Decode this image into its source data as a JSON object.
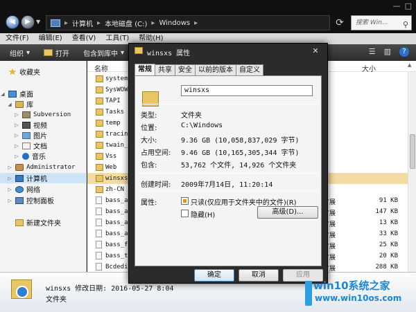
{
  "address": {
    "segments": [
      "计算机",
      "本地磁盘 (C:)",
      "Windows"
    ],
    "search_placeholder": "搜索 Win..."
  },
  "menu": [
    "文件(F)",
    "编辑(E)",
    "查看(V)",
    "工具(T)",
    "帮助(H)"
  ],
  "toolbar": {
    "organize": "组织",
    "open": "打开",
    "include_in_library": "包含到库中"
  },
  "navpane": {
    "favorites": "收藏夹",
    "desktop": "桌面",
    "libraries": "库",
    "subversion": "Subversion",
    "videos": "视频",
    "pictures": "图片",
    "documents": "文档",
    "music": "音乐",
    "administrator": "Administrator",
    "computer": "计算机",
    "network": "网络",
    "control_panel": "控制面板",
    "new_folder": "新建文件夹"
  },
  "filelist": {
    "col_name": "名称",
    "col_size": "大小",
    "rows": [
      {
        "name": "system",
        "type": "",
        "size": "",
        "kind": "folder"
      },
      {
        "name": "SysWOW",
        "type": "",
        "size": "",
        "kind": "folder"
      },
      {
        "name": "TAPI",
        "type": "",
        "size": "",
        "kind": "folder"
      },
      {
        "name": "Tasks",
        "type": "",
        "size": "",
        "kind": "folder"
      },
      {
        "name": "temp",
        "type": "",
        "size": "",
        "kind": "folder"
      },
      {
        "name": "tracin",
        "type": "",
        "size": "",
        "kind": "folder"
      },
      {
        "name": "twain_",
        "type": "",
        "size": "",
        "kind": "folder"
      },
      {
        "name": "Vss",
        "type": "",
        "size": "",
        "kind": "folder"
      },
      {
        "name": "Web",
        "type": "",
        "size": "",
        "kind": "folder"
      },
      {
        "name": "winsxs",
        "type": "",
        "size": "",
        "kind": "folder"
      },
      {
        "name": "zh-CN",
        "type": "",
        "size": "",
        "kind": "folder"
      },
      {
        "name": "bass_a",
        "type": "扩展",
        "size": "91 KB",
        "kind": "file"
      },
      {
        "name": "bass_a",
        "type": "扩展",
        "size": "147 KB",
        "kind": "file"
      },
      {
        "name": "bass_a",
        "type": "扩展",
        "size": "13 KB",
        "kind": "file"
      },
      {
        "name": "bass_a",
        "type": "扩展",
        "size": "33 KB",
        "kind": "file"
      },
      {
        "name": "bass_f",
        "type": "扩展",
        "size": "25 KB",
        "kind": "file"
      },
      {
        "name": "bass_t",
        "type": "扩展",
        "size": "20 KB",
        "kind": "file"
      },
      {
        "name": "Bcdedi",
        "type": "扩展",
        "size": "288 KB",
        "kind": "file"
      }
    ]
  },
  "details": {
    "name_line": "winsxs 修改日期: 2016-05-27 8:04",
    "type": "文件夹"
  },
  "dialog": {
    "title": "winsxs 属性",
    "close_glyph": "✕",
    "tabs": [
      "常规",
      "共享",
      "安全",
      "以前的版本",
      "自定义"
    ],
    "folder_name": "winsxs",
    "props": [
      {
        "label": "类型:",
        "value": "文件夹"
      },
      {
        "label": "位置:",
        "value": "C:\\Windows"
      },
      {
        "label": "大小:",
        "value": "9.36 GB (10,058,837,029 字节)"
      },
      {
        "label": "占用空间:",
        "value": "9.46 GB (10,165,305,344 字节)"
      },
      {
        "label": "包含:",
        "value": "53,762 个文件, 14,926 个文件夹"
      },
      {
        "label": "创建时间:",
        "value": "2009年7月14日, 11:20:14"
      }
    ],
    "attributes_label": "属性:",
    "readonly_label": "只读(仅应用于文件夹中的文件)(R)",
    "hidden_label": "隐藏(H)",
    "advanced_button": "高级(D)...",
    "ok": "确定",
    "cancel": "取消",
    "apply": "应用"
  },
  "watermark": {
    "title": "win10系统之家",
    "url": "www.win10os.com"
  }
}
